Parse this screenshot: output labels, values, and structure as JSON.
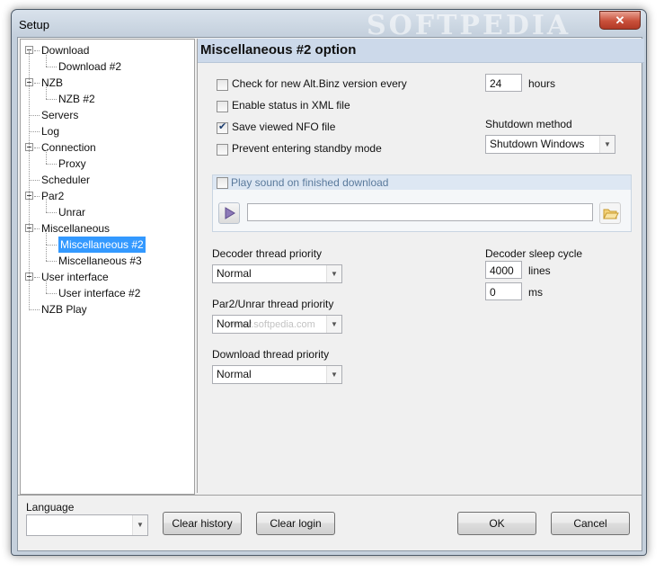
{
  "window": {
    "title": "Setup",
    "watermark": "SOFTPEDIA",
    "close_glyph": "✕"
  },
  "tree": [
    {
      "label": "Download",
      "expander": true
    },
    {
      "label": "Download #2"
    },
    {
      "label": "NZB",
      "expander": true
    },
    {
      "label": "NZB #2"
    },
    {
      "label": "Servers"
    },
    {
      "label": "Log"
    },
    {
      "label": "Connection",
      "expander": true
    },
    {
      "label": "Proxy"
    },
    {
      "label": "Scheduler"
    },
    {
      "label": "Par2",
      "expander": true
    },
    {
      "label": "Unrar"
    },
    {
      "label": "Miscellaneous",
      "expander": true
    },
    {
      "label": "Miscellaneous #2",
      "selected": true
    },
    {
      "label": "Miscellaneous #3"
    },
    {
      "label": "User interface",
      "expander": true
    },
    {
      "label": "User interface #2"
    },
    {
      "label": "NZB Play"
    }
  ],
  "panel": {
    "title": "Miscellaneous #2 option",
    "check_version": {
      "label": "Check for new Alt.Binz version every",
      "checked": false
    },
    "hours": {
      "value": "24",
      "unit": "hours"
    },
    "xml_status": {
      "label": "Enable status in XML file",
      "checked": false
    },
    "save_nfo": {
      "label": "Save viewed NFO file",
      "checked": true
    },
    "standby": {
      "label": "Prevent entering standby mode",
      "checked": false
    },
    "shutdown": {
      "label": "Shutdown method",
      "value": "Shutdown Windows"
    },
    "sound": {
      "label": "Play sound on finished download",
      "checked": false,
      "path": ""
    },
    "decoder_priority": {
      "label": "Decoder thread priority",
      "value": "Normal"
    },
    "par2_priority": {
      "label": "Par2/Unrar thread priority",
      "value": "Normal"
    },
    "download_priority": {
      "label": "Download thread priority",
      "value": "Normal"
    },
    "sleep": {
      "label": "Decoder sleep cycle",
      "lines_value": "4000",
      "lines_unit": "lines",
      "ms_value": "0",
      "ms_unit": "ms"
    },
    "ghost_watermark": "www.softpedia.com"
  },
  "bottom": {
    "language_label": "Language",
    "language_value": "",
    "clear_history": "Clear history",
    "clear_login": "Clear login",
    "ok": "OK",
    "cancel": "Cancel"
  },
  "icons": {
    "play": "play-icon",
    "folder": "folder-icon"
  }
}
